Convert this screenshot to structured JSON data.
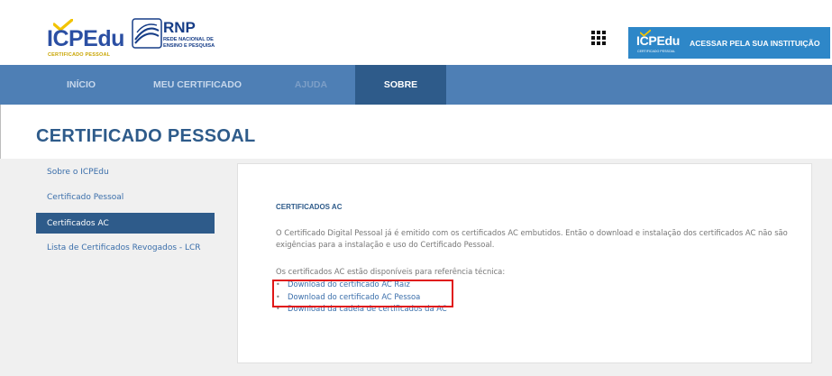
{
  "header": {
    "icpedu_logo": {
      "wordmark": "ICPEdu",
      "subtitle": "CERTIFICADO PESSOAL"
    },
    "rnp_logo": {
      "wordmark": "RNP",
      "line1": "REDE NACIONAL DE",
      "line2": "ENSINO E PESQUISA"
    },
    "apps_icon": "grid-icon",
    "access_button": {
      "mini_logo": "ICPEdu",
      "mini_sub": "CERTIFICADO PESSOAL",
      "label": "ACESSAR PELA SUA INSTITUIÇÃO"
    }
  },
  "nav": {
    "items": [
      {
        "label": "INÍCIO"
      },
      {
        "label": "MEU CERTIFICADO"
      },
      {
        "label": "AJUDA"
      },
      {
        "label": "SOBRE"
      }
    ],
    "active": "SOBRE"
  },
  "page": {
    "title": "CERTIFICADO PESSOAL"
  },
  "sidebar": {
    "items": [
      {
        "label": "Sobre o ICPEdu"
      },
      {
        "label": "Certificado Pessoal"
      },
      {
        "label": "Certificados AC"
      },
      {
        "label": "Lista de Certificados Revogados - LCR"
      }
    ],
    "active": "Certificados AC"
  },
  "card": {
    "heading": "CERTIFICADOS AC",
    "paragraph1": "O Certificado Digital Pessoal já é emitido com os certificados AC embutidos. Então o download e instalação dos certificados AC não são exigências para a instalação e uso do Certificado Pessoal.",
    "paragraph2": "Os certificados AC estão disponíveis para referência técnica:",
    "links": [
      {
        "label": "Download do certificado AC Raiz"
      },
      {
        "label": "Download do certificado AC Pessoa"
      },
      {
        "label": "Download da cadeia de certificados da AC"
      }
    ]
  },
  "colors": {
    "nav_bg": "#4e7fb5",
    "nav_active": "#2e5b8a",
    "accent": "#2e87c8",
    "highlight": "#e01818"
  }
}
